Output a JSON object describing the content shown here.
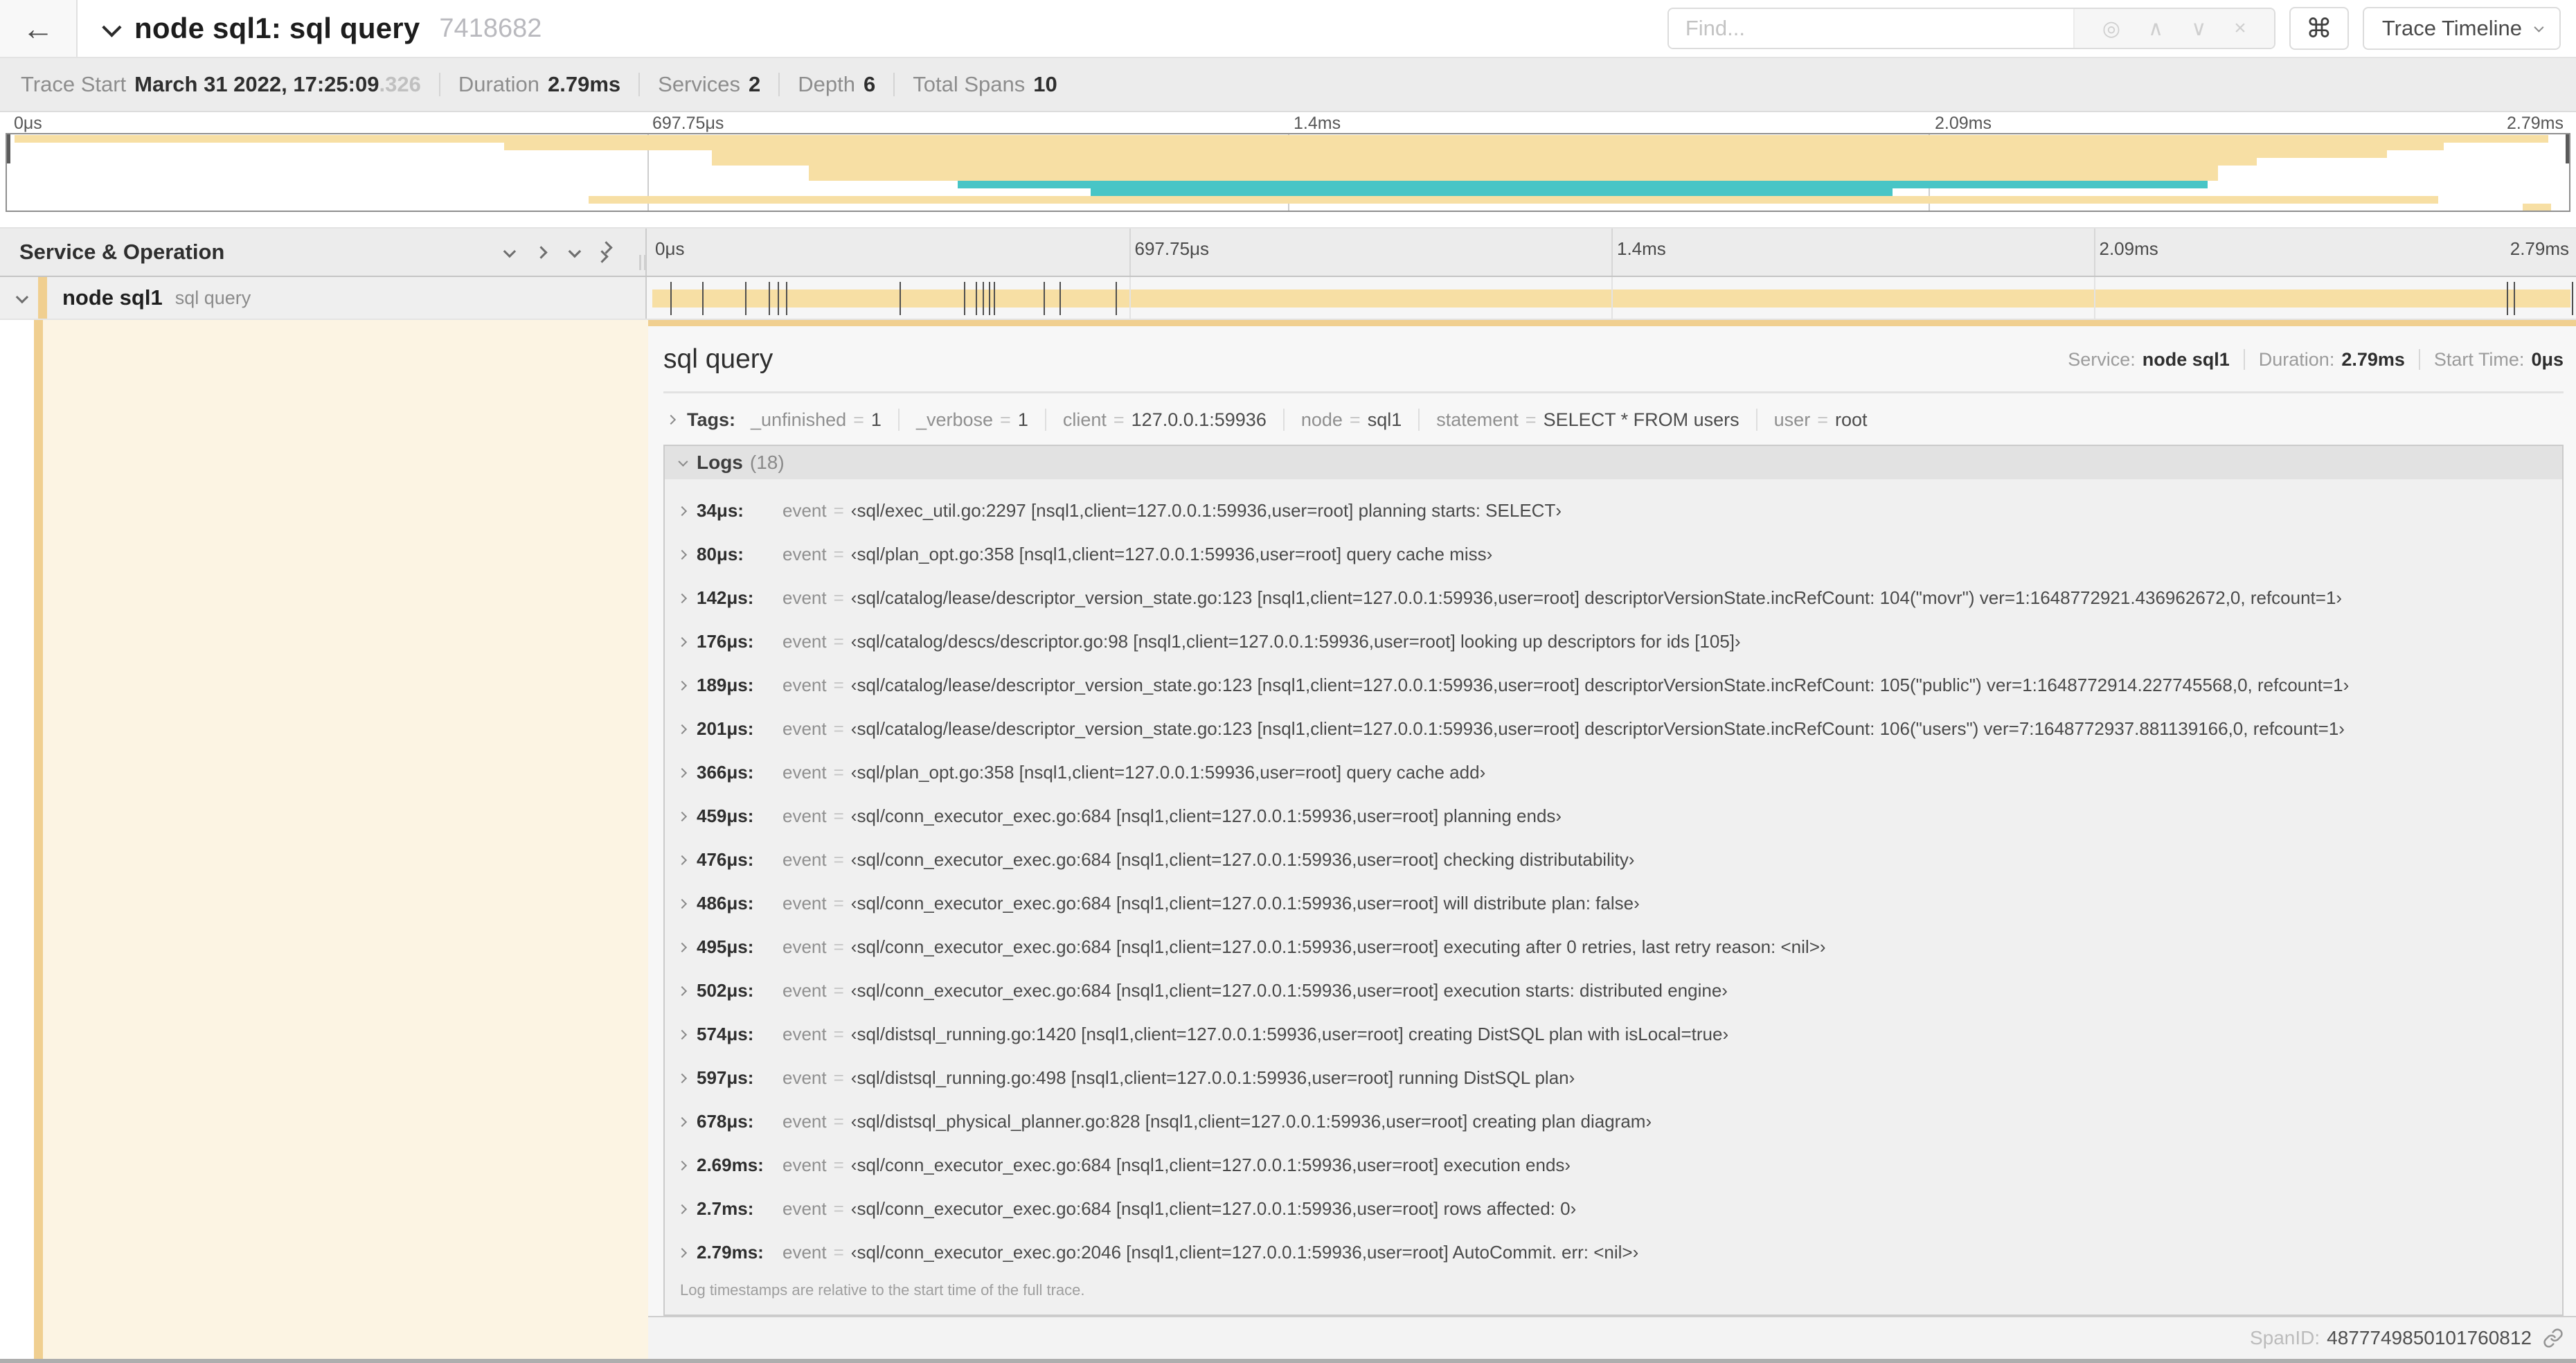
{
  "header": {
    "back_glyph": "←",
    "title": "node sql1: sql query",
    "trace_id": "7418682",
    "find_placeholder": "Find...",
    "find_icons": {
      "target": "◎",
      "prev": "∧",
      "next": "∨",
      "clear": "×"
    },
    "shortcut_glyph": "⌘",
    "view_button": "Trace Timeline"
  },
  "summary": {
    "items": [
      {
        "label": "Trace Start",
        "value": "March 31 2022, 17:25:09",
        "suffix": ".326"
      },
      {
        "label": "Duration",
        "value": "2.79ms",
        "suffix": ""
      },
      {
        "label": "Services",
        "value": "2",
        "suffix": ""
      },
      {
        "label": "Depth",
        "value": "6",
        "suffix": ""
      },
      {
        "label": "Total Spans",
        "value": "10",
        "suffix": ""
      }
    ]
  },
  "timeline": {
    "column_header": "Service & Operation",
    "ticks": [
      {
        "label": "0μs",
        "pct": 0
      },
      {
        "label": "697.75μs",
        "pct": 25
      },
      {
        "label": "1.4ms",
        "pct": 50
      },
      {
        "label": "2.09ms",
        "pct": 75
      },
      {
        "label": "2.79ms",
        "pct": 100
      }
    ],
    "grid_pcts": [
      25,
      50,
      75
    ]
  },
  "minimap": {
    "bars": [
      {
        "row": 0,
        "start": 0.3,
        "end": 99.2,
        "color": "tan"
      },
      {
        "row": 1,
        "start": 19.4,
        "end": 95.1,
        "color": "tan"
      },
      {
        "row": 2,
        "start": 27.5,
        "end": 92.9,
        "color": "tan"
      },
      {
        "row": 3,
        "start": 27.5,
        "end": 87.8,
        "color": "tan"
      },
      {
        "row": 4,
        "start": 31.3,
        "end": 86.3,
        "color": "tan"
      },
      {
        "row": 5,
        "start": 31.3,
        "end": 86.3,
        "color": "tan"
      },
      {
        "row": 6,
        "start": 37.1,
        "end": 85.9,
        "color": "teal"
      },
      {
        "row": 7,
        "start": 42.3,
        "end": 73.6,
        "color": "teal"
      },
      {
        "row": 8,
        "start": 22.7,
        "end": 94.9,
        "color": "tan"
      },
      {
        "row": 9,
        "start": 98.2,
        "end": 99.3,
        "color": "tan"
      }
    ]
  },
  "span_row": {
    "service": "node sql1",
    "operation": "sql query",
    "duration_total_us": 2790,
    "log_ticks_us": [
      34,
      80,
      142,
      176,
      189,
      201,
      366,
      459,
      476,
      486,
      495,
      502,
      574,
      597,
      678,
      2690,
      2700,
      2786
    ]
  },
  "span_detail": {
    "title": "sql query",
    "meta": [
      {
        "label": "Service:",
        "value": "node sql1"
      },
      {
        "label": "Duration:",
        "value": "2.79ms"
      },
      {
        "label": "Start Time:",
        "value": "0μs"
      }
    ],
    "tags_label": "Tags:",
    "eq_sign": "=",
    "tags": [
      {
        "key": "_unfinished",
        "value": "1"
      },
      {
        "key": "_verbose",
        "value": "1"
      },
      {
        "key": "client",
        "value": "127.0.0.1:59936"
      },
      {
        "key": "node",
        "value": "sql1"
      },
      {
        "key": "statement",
        "value": "SELECT * FROM users"
      },
      {
        "key": "user",
        "value": "root"
      }
    ],
    "logs_label": "Logs",
    "logs_count": "(18)",
    "event_key": "event",
    "logs": [
      {
        "time": "34μs:",
        "value": "‹sql/exec_util.go:2297 [nsql1,client=127.0.0.1:59936,user=root] planning starts: SELECT›"
      },
      {
        "time": "80μs:",
        "value": "‹sql/plan_opt.go:358 [nsql1,client=127.0.0.1:59936,user=root] query cache miss›"
      },
      {
        "time": "142μs:",
        "value": "‹sql/catalog/lease/descriptor_version_state.go:123 [nsql1,client=127.0.0.1:59936,user=root] descriptorVersionState.incRefCount: 104(\"movr\") ver=1:1648772921.436962672,0, refcount=1›"
      },
      {
        "time": "176μs:",
        "value": "‹sql/catalog/descs/descriptor.go:98 [nsql1,client=127.0.0.1:59936,user=root] looking up descriptors for ids [105]›"
      },
      {
        "time": "189μs:",
        "value": "‹sql/catalog/lease/descriptor_version_state.go:123 [nsql1,client=127.0.0.1:59936,user=root] descriptorVersionState.incRefCount: 105(\"public\") ver=1:1648772914.227745568,0, refcount=1›"
      },
      {
        "time": "201μs:",
        "value": "‹sql/catalog/lease/descriptor_version_state.go:123 [nsql1,client=127.0.0.1:59936,user=root] descriptorVersionState.incRefCount: 106(\"users\") ver=7:1648772937.881139166,0, refcount=1›"
      },
      {
        "time": "366μs:",
        "value": "‹sql/plan_opt.go:358 [nsql1,client=127.0.0.1:59936,user=root] query cache add›"
      },
      {
        "time": "459μs:",
        "value": "‹sql/conn_executor_exec.go:684 [nsql1,client=127.0.0.1:59936,user=root] planning ends›"
      },
      {
        "time": "476μs:",
        "value": "‹sql/conn_executor_exec.go:684 [nsql1,client=127.0.0.1:59936,user=root] checking distributability›"
      },
      {
        "time": "486μs:",
        "value": "‹sql/conn_executor_exec.go:684 [nsql1,client=127.0.0.1:59936,user=root] will distribute plan: false›"
      },
      {
        "time": "495μs:",
        "value": "‹sql/conn_executor_exec.go:684 [nsql1,client=127.0.0.1:59936,user=root] executing after 0 retries, last retry reason: <nil>›"
      },
      {
        "time": "502μs:",
        "value": "‹sql/conn_executor_exec.go:684 [nsql1,client=127.0.0.1:59936,user=root] execution starts: distributed engine›"
      },
      {
        "time": "574μs:",
        "value": "‹sql/distsql_running.go:1420 [nsql1,client=127.0.0.1:59936,user=root] creating DistSQL plan with isLocal=true›"
      },
      {
        "time": "597μs:",
        "value": "‹sql/distsql_running.go:498 [nsql1,client=127.0.0.1:59936,user=root] running DistSQL plan›"
      },
      {
        "time": "678μs:",
        "value": "‹sql/distsql_physical_planner.go:828 [nsql1,client=127.0.0.1:59936,user=root] creating plan diagram›"
      },
      {
        "time": "2.69ms:",
        "value": "‹sql/conn_executor_exec.go:684 [nsql1,client=127.0.0.1:59936,user=root] execution ends›"
      },
      {
        "time": "2.7ms:",
        "value": "‹sql/conn_executor_exec.go:684 [nsql1,client=127.0.0.1:59936,user=root] rows affected: 0›"
      },
      {
        "time": "2.79ms:",
        "value": "‹sql/conn_executor_exec.go:2046 [nsql1,client=127.0.0.1:59936,user=root] AutoCommit. err: <nil>›"
      }
    ],
    "logs_note": "Log timestamps are relative to the start time of the full trace.",
    "spanid_label": "SpanID:",
    "spanid": "4877749850101760812"
  },
  "colors": {
    "span_tan": "#F7DFA4",
    "span_tan_dark": "#F0CF90",
    "span_teal": "#48C5C6",
    "pale_column": "#FCF4E3"
  }
}
